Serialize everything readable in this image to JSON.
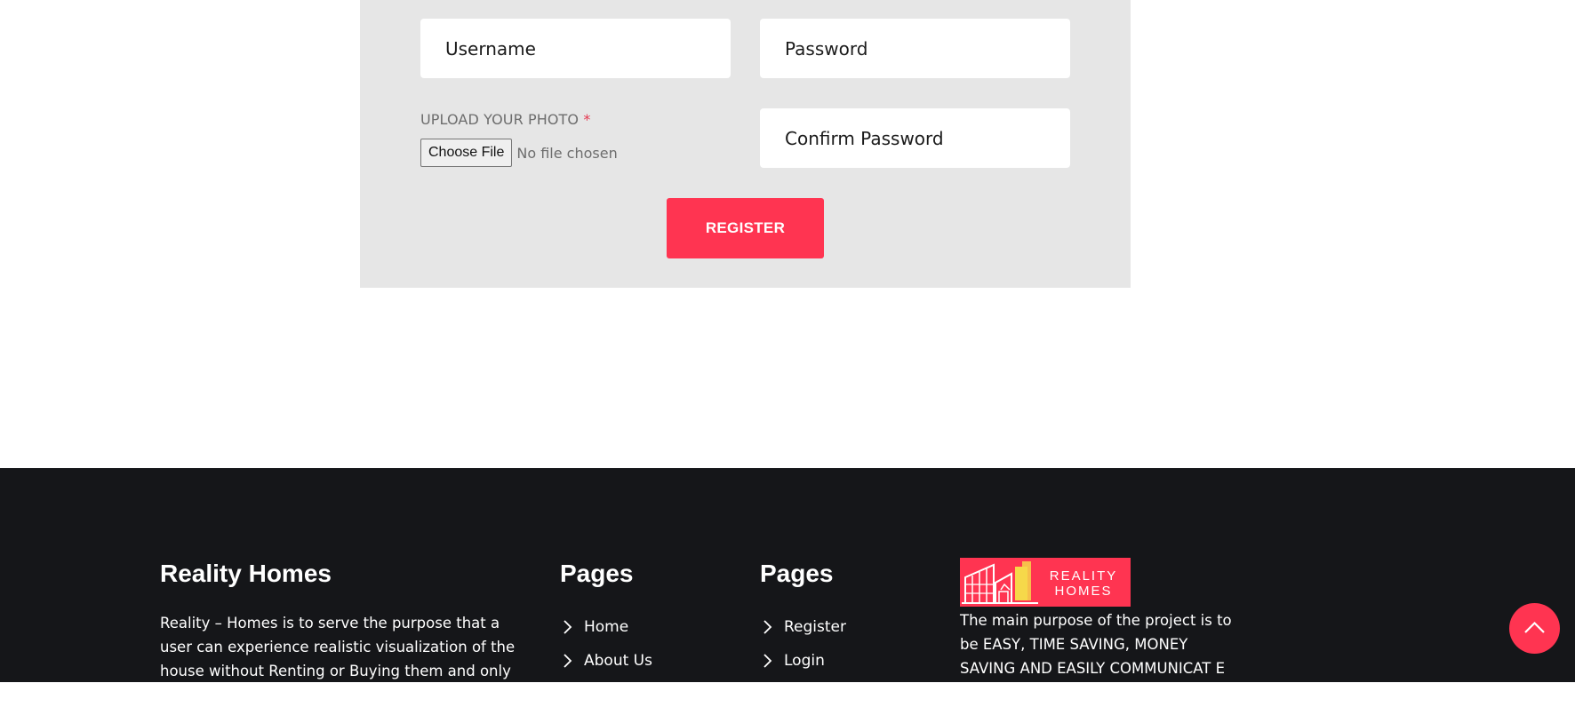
{
  "form": {
    "username_placeholder": "Username",
    "password_placeholder": "Password",
    "confirm_password_placeholder": "Confirm Password",
    "upload_label": "UPLOAD YOUR PHOTO",
    "required_marker": "*",
    "choose_file_label": "Choose File",
    "no_file_text": "No file chosen",
    "register_label": "REGISTER"
  },
  "footer": {
    "about": {
      "title": "Reality Homes",
      "text": "Reality – Homes is to serve the purpose that a user can experience realistic visualization of the house without Renting or Buying them and only with the"
    },
    "pages_a": {
      "title": "Pages",
      "links": [
        "Home",
        "About Us"
      ]
    },
    "pages_b": {
      "title": "Pages",
      "links": [
        "Register",
        "Login"
      ]
    },
    "logo": {
      "line1": "REALITY",
      "line2": "HOMES"
    },
    "purpose_text": "The main purpose of the project is to be EASY, TIME SAVING, MONEY SAVING AND EASILY COMMUNICAT E"
  },
  "scroll_top": {
    "icon": "chevron-up-icon"
  },
  "colors": {
    "accent": "#ff3451",
    "form_bg": "#e6e6e6",
    "footer_bg": "#151619"
  }
}
